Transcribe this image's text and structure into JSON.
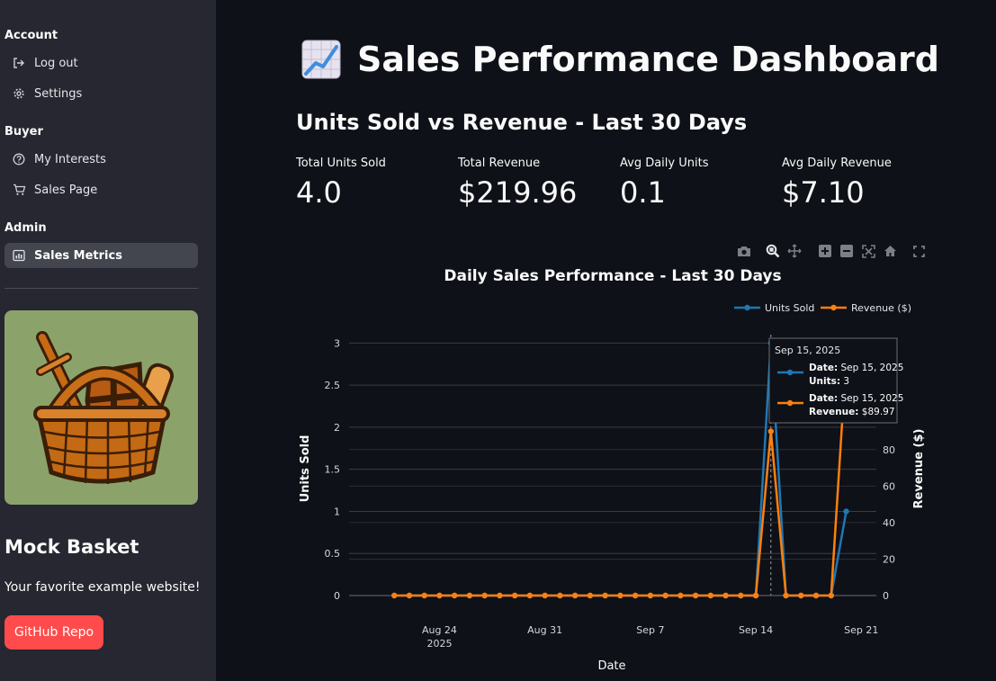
{
  "sidebar": {
    "sections": [
      {
        "title": "Account"
      },
      {
        "title": "Buyer"
      },
      {
        "title": "Admin"
      }
    ],
    "items": [
      {
        "label": "Log out",
        "icon": "logout-icon"
      },
      {
        "label": "Settings",
        "icon": "gear-icon"
      },
      {
        "label": "My Interests",
        "icon": "help-circle-icon"
      },
      {
        "label": "Sales Page",
        "icon": "cart-icon"
      },
      {
        "label": "Sales Metrics",
        "icon": "chart-table-icon",
        "active": true
      }
    ],
    "brand_title": "Mock Basket",
    "brand_subtitle": "Your favorite example website!",
    "github_button": "GitHub Repo"
  },
  "main": {
    "title_emoji": "chart-increasing-icon",
    "title": "Sales Performance Dashboard",
    "subtitle": "Units Sold vs Revenue - Last 30 Days",
    "metrics": [
      {
        "label": "Total Units Sold",
        "value": "4.0"
      },
      {
        "label": "Total Revenue",
        "value": "$219.96"
      },
      {
        "label": "Avg Daily Units",
        "value": "0.1"
      },
      {
        "label": "Avg Daily Revenue",
        "value": "$7.10"
      }
    ]
  },
  "colors": {
    "units": "#1f77b4",
    "revenue": "#ff7f0e",
    "accent_button": "#ff4b4b",
    "background": "#0e1117",
    "sidebar": "#262730"
  },
  "chart_data": {
    "type": "line",
    "title": "Daily Sales Performance - Last 30 Days",
    "xlabel": "Date",
    "ylabel": "Units Sold",
    "y2label": "Revenue ($)",
    "x_ticks": [
      {
        "date": "2025-08-24",
        "label": "Aug 24",
        "sublabel": "2025"
      },
      {
        "date": "2025-08-31",
        "label": "Aug 31"
      },
      {
        "date": "2025-09-07",
        "label": "Sep 7"
      },
      {
        "date": "2025-09-14",
        "label": "Sep 14"
      },
      {
        "date": "2025-09-21",
        "label": "Sep 21"
      }
    ],
    "xlim": [
      "2025-08-18",
      "2025-09-22"
    ],
    "y_ticks": [
      "0",
      "0.5",
      "1",
      "1.5",
      "2",
      "2.5",
      "3"
    ],
    "ylim": [
      0,
      3.1
    ],
    "y2_ticks": [
      "0",
      "20",
      "40",
      "60",
      "80"
    ],
    "y2lim": [
      0,
      143
    ],
    "legend_position": "top-right",
    "x": [
      "2025-08-21",
      "2025-08-22",
      "2025-08-23",
      "2025-08-24",
      "2025-08-25",
      "2025-08-26",
      "2025-08-27",
      "2025-08-28",
      "2025-08-29",
      "2025-08-30",
      "2025-08-31",
      "2025-09-01",
      "2025-09-02",
      "2025-09-03",
      "2025-09-04",
      "2025-09-05",
      "2025-09-06",
      "2025-09-07",
      "2025-09-08",
      "2025-09-09",
      "2025-09-10",
      "2025-09-11",
      "2025-09-12",
      "2025-09-13",
      "2025-09-14",
      "2025-09-15",
      "2025-09-16",
      "2025-09-17",
      "2025-09-18",
      "2025-09-19",
      "2025-09-20"
    ],
    "series": [
      {
        "name": "Units Sold",
        "axis": "y",
        "values": [
          0,
          0,
          0,
          0,
          0,
          0,
          0,
          0,
          0,
          0,
          0,
          0,
          0,
          0,
          0,
          0,
          0,
          0,
          0,
          0,
          0,
          0,
          0,
          0,
          0,
          3,
          0,
          0,
          0,
          0,
          1
        ]
      },
      {
        "name": "Revenue ($)",
        "axis": "y2",
        "values": [
          0,
          0,
          0,
          0,
          0,
          0,
          0,
          0,
          0,
          0,
          0,
          0,
          0,
          0,
          0,
          0,
          0,
          0,
          0,
          0,
          0,
          0,
          0,
          0,
          0,
          89.97,
          0,
          0,
          0,
          0,
          129.99
        ]
      }
    ],
    "hover": {
      "header": "Sep 15, 2025",
      "rows": [
        {
          "date_label": "Date:",
          "date": "Sep 15, 2025",
          "value_label": "Units:",
          "value": "3"
        },
        {
          "date_label": "Date:",
          "date": "Sep 15, 2025",
          "value_label": "Revenue:",
          "value": "$89.97"
        }
      ]
    }
  }
}
